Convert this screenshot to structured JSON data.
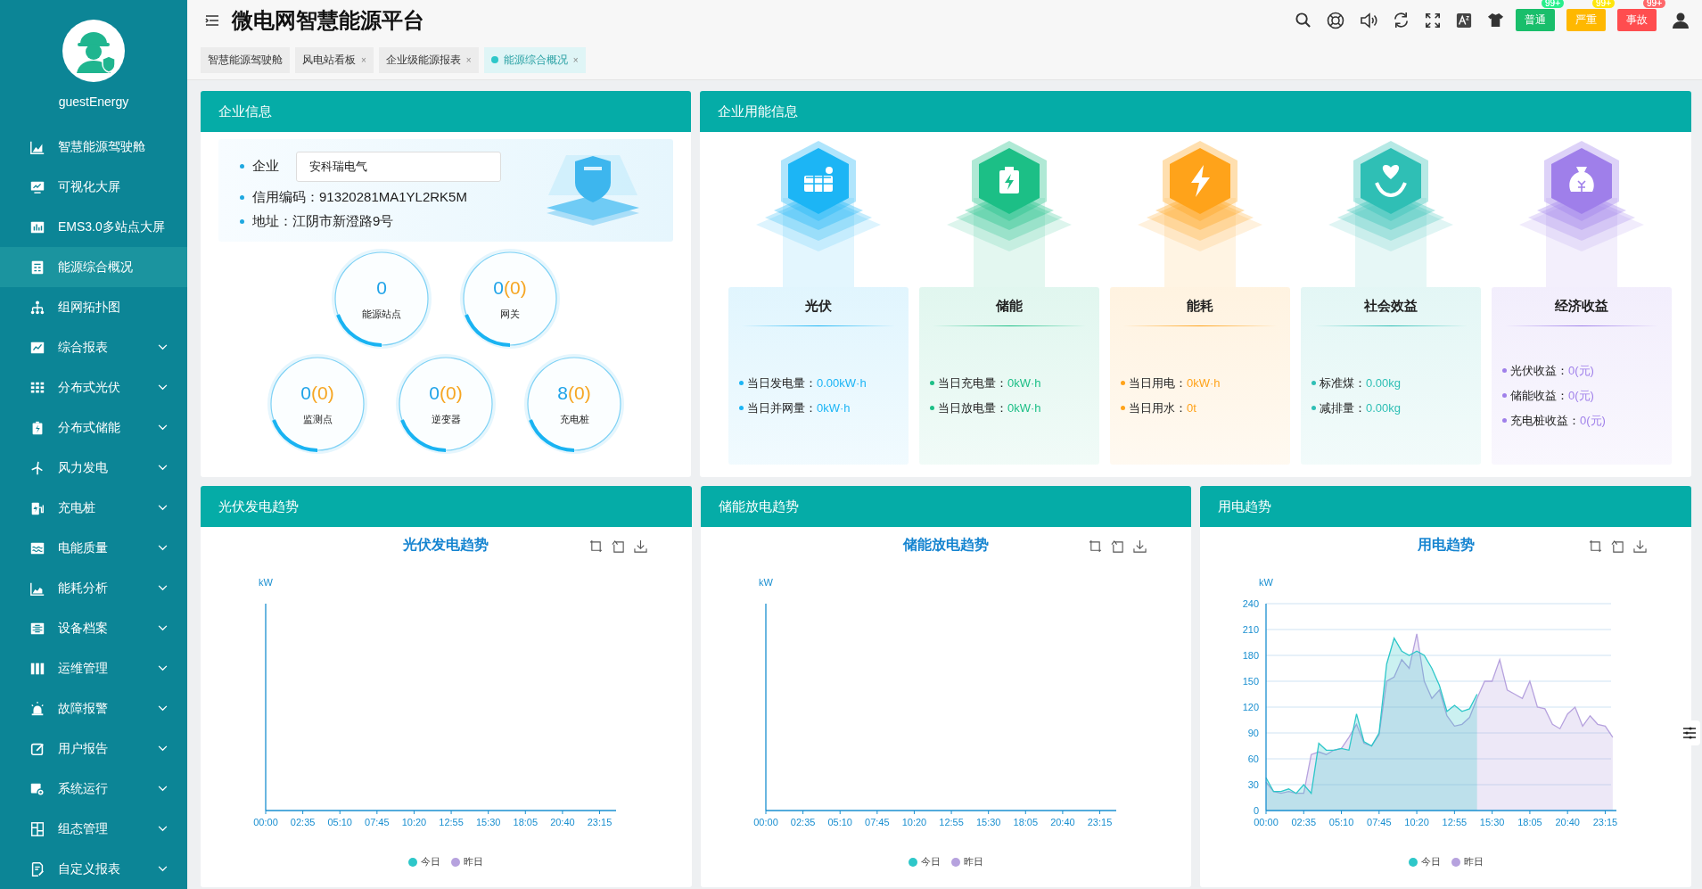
{
  "sidebar": {
    "user": "guestEnergy",
    "items": [
      {
        "label": "智慧能源驾驶舱",
        "selected": false,
        "submenu": false
      },
      {
        "label": "可视化大屏",
        "selected": false,
        "submenu": false
      },
      {
        "label": "EMS3.0多站点大屏",
        "selected": false,
        "submenu": false
      },
      {
        "label": "能源综合概况",
        "selected": true,
        "submenu": false
      },
      {
        "label": "组网拓扑图",
        "selected": false,
        "submenu": false
      },
      {
        "label": "综合报表",
        "selected": false,
        "submenu": true
      },
      {
        "label": "分布式光伏",
        "selected": false,
        "submenu": true
      },
      {
        "label": "分布式储能",
        "selected": false,
        "submenu": true
      },
      {
        "label": "风力发电",
        "selected": false,
        "submenu": true
      },
      {
        "label": "充电桩",
        "selected": false,
        "submenu": true
      },
      {
        "label": "电能质量",
        "selected": false,
        "submenu": true
      },
      {
        "label": "能耗分析",
        "selected": false,
        "submenu": true
      },
      {
        "label": "设备档案",
        "selected": false,
        "submenu": true
      },
      {
        "label": "运维管理",
        "selected": false,
        "submenu": true
      },
      {
        "label": "故障报警",
        "selected": false,
        "submenu": true
      },
      {
        "label": "用户报告",
        "selected": false,
        "submenu": true
      },
      {
        "label": "系统运行",
        "selected": false,
        "submenu": true
      },
      {
        "label": "组态管理",
        "selected": false,
        "submenu": true
      },
      {
        "label": "自定义报表",
        "selected": false,
        "submenu": true
      }
    ]
  },
  "header": {
    "title": "微电网智慧能源平台",
    "alerts": [
      {
        "label": "普通",
        "count": "99+",
        "color": "#19be6b"
      },
      {
        "label": "严重",
        "count": "99+",
        "color": "#ffb800"
      },
      {
        "label": "事故",
        "count": "99+",
        "color": "#ff4d4f"
      }
    ]
  },
  "tabs": [
    {
      "label": "智慧能源驾驶舱",
      "selected": false
    },
    {
      "label": "风电站看板",
      "selected": false,
      "close": "×"
    },
    {
      "label": "企业级能源报表",
      "selected": false,
      "close": "×"
    },
    {
      "label": "能源综合概况",
      "selected": true,
      "close": "×"
    }
  ],
  "company": {
    "title": "企业信息",
    "field_label": "企业",
    "field_value": "安科瑞电气",
    "lines": [
      "信用编码：91320281MA1YL2RK5M",
      "地址：江阴市新澄路9号"
    ],
    "gauges": [
      {
        "value": "0",
        "label": "能源站点"
      },
      {
        "value": "0",
        "sub": "(0)",
        "label": "网关"
      },
      {
        "value": "0",
        "sub": "(0)",
        "label": "监测点"
      },
      {
        "value": "0",
        "sub": "(0)",
        "label": "逆变器"
      },
      {
        "value": "8",
        "sub": "(0)",
        "label": "充电桩"
      }
    ]
  },
  "usage": {
    "title": "企业用能信息",
    "cards": [
      {
        "title": "光伏",
        "color": "#1cb5f5",
        "items": [
          {
            "label": "当日发电量：",
            "value": "0.00kW·h"
          },
          {
            "label": "当日并网量：",
            "value": "0kW·h"
          }
        ]
      },
      {
        "title": "储能",
        "color": "#1cbf86",
        "items": [
          {
            "label": "当日充电量：",
            "value": "0kW·h"
          },
          {
            "label": "当日放电量：",
            "value": "0kW·h"
          }
        ]
      },
      {
        "title": "能耗",
        "color": "#ffa31a",
        "items": [
          {
            "label": "当日用电：",
            "value": "0kW·h"
          },
          {
            "label": "当日用水：",
            "value": "0t"
          }
        ]
      },
      {
        "title": "社会效益",
        "color": "#2fbfb5",
        "items": [
          {
            "label": "标准煤：",
            "value": "0.00kg"
          },
          {
            "label": "减排量：",
            "value": "0.00kg"
          }
        ]
      },
      {
        "title": "经济收益",
        "color": "#9f7fea",
        "items": [
          {
            "label": "光伏收益：",
            "value": "0(元)"
          },
          {
            "label": "储能收益：",
            "value": "0(元)"
          },
          {
            "label": "充电桩收益：",
            "value": "0(元)"
          }
        ]
      }
    ]
  },
  "charts": [
    {
      "title": "光伏发电趋势",
      "empty_chart": {
        "title": "光伏发电趋势",
        "unit": "kW",
        "x_labels": [
          "00:00",
          "02:35",
          "05:10",
          "07:45",
          "10:20",
          "12:55",
          "15:30",
          "18:05",
          "20:40",
          "23:15"
        ],
        "legend": [
          {
            "name": "今日",
            "color": "#2ec7c9"
          },
          {
            "name": "昨日",
            "color": "#b6a2de"
          }
        ]
      }
    },
    {
      "title": "储能放电趋势",
      "empty_chart": {
        "title": "储能放电趋势",
        "unit": "kW",
        "x_labels": [
          "00:00",
          "02:35",
          "05:10",
          "07:45",
          "10:20",
          "12:55",
          "15:30",
          "18:05",
          "20:40",
          "23:15"
        ],
        "legend": [
          {
            "name": "今日",
            "color": "#2ec7c9"
          },
          {
            "name": "昨日",
            "color": "#b6a2de"
          }
        ]
      }
    },
    {
      "title": "用电趋势",
      "chart_data": {
        "type": "area",
        "title": "用电趋势",
        "ylabel": "kW",
        "grid": true,
        "legend": "bottom",
        "x": [
          0,
          31,
          62,
          93,
          124,
          155,
          186,
          217,
          248,
          279,
          310,
          341,
          372,
          403,
          434,
          465,
          496,
          527,
          558,
          589,
          620,
          651,
          682,
          713,
          744,
          775,
          806,
          837,
          868,
          899,
          930,
          961,
          992,
          1023,
          1054,
          1085,
          1116,
          1147,
          1178,
          1209,
          1240,
          1271,
          1302,
          1333,
          1364,
          1395,
          1426
        ],
        "xlim": [
          0,
          1441
        ],
        "xticks": [
          {
            "value": 0,
            "label": "00:00"
          },
          {
            "value": 155,
            "label": "02:35"
          },
          {
            "value": 310,
            "label": "05:10"
          },
          {
            "value": 465,
            "label": "07:45"
          },
          {
            "value": 620,
            "label": "10:20"
          },
          {
            "value": 775,
            "label": "12:55"
          },
          {
            "value": 930,
            "label": "15:30"
          },
          {
            "value": 1085,
            "label": "18:05"
          },
          {
            "value": 1240,
            "label": "20:40"
          },
          {
            "value": 1395,
            "label": "23:15"
          }
        ],
        "ylim": [
          0,
          240
        ],
        "yticks": [
          0,
          30,
          60,
          90,
          120,
          150,
          180,
          210,
          240
        ],
        "series": [
          {
            "name": "今日",
            "color": "#2ec7c9",
            "values": [
              38,
              22,
              22,
              25,
              20,
              30,
              20,
              78,
              70,
              70,
              72,
              70,
              112,
              80,
              75,
              90,
              170,
              200,
              185,
              180,
              185,
              180,
              165,
              145,
              115,
              122,
              115,
              118,
              135,
              null,
              null,
              null,
              null,
              null,
              null,
              null,
              null,
              null,
              null,
              null,
              null,
              null,
              null,
              null,
              null,
              null,
              null
            ]
          },
          {
            "name": "昨日",
            "color": "#b6a2de",
            "values": [
              33,
              22,
              20,
              22,
              20,
              20,
              65,
              68,
              65,
              70,
              72,
              85,
              100,
              78,
              75,
              88,
              150,
              155,
              175,
              165,
              205,
              150,
              130,
              140,
              110,
              98,
              100,
              108,
              130,
              150,
              150,
              175,
              140,
              135,
              130,
              150,
              120,
              118,
              100,
              95,
              112,
              120,
              98,
              110,
              100,
              98,
              85
            ]
          }
        ]
      }
    }
  ]
}
